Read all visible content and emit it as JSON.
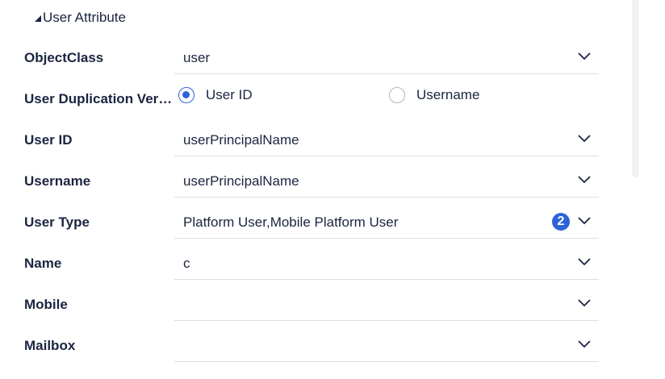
{
  "section": {
    "title": "User Attribute"
  },
  "rows": [
    {
      "label": "ObjectClass",
      "value": "user"
    },
    {
      "label": "User Duplication Verification",
      "options": [
        "User ID",
        "Username"
      ],
      "selected": "User ID"
    },
    {
      "label": "User ID",
      "value": "userPrincipalName"
    },
    {
      "label": "Username",
      "value": "userPrincipalName"
    },
    {
      "label": "User Type",
      "value": "Platform User,Mobile Platform User",
      "badge": "2"
    },
    {
      "label": "Name",
      "value": "c"
    },
    {
      "label": "Mobile",
      "value": ""
    },
    {
      "label": "Mailbox",
      "value": ""
    }
  ],
  "colors": {
    "accent": "#2f63d8",
    "text": "#1b2540"
  }
}
